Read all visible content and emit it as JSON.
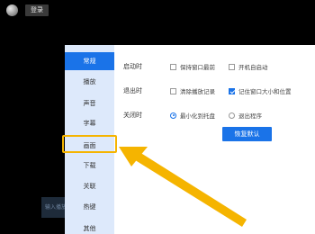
{
  "header": {
    "login_label": "登录"
  },
  "bottom_input": {
    "placeholder": "输入播放"
  },
  "sidebar": {
    "items": [
      {
        "label": "常规"
      },
      {
        "label": "播放"
      },
      {
        "label": "声音"
      },
      {
        "label": "字幕"
      },
      {
        "label": "画面"
      },
      {
        "label": "下载"
      },
      {
        "label": "关联"
      },
      {
        "label": "热键"
      },
      {
        "label": "其他"
      }
    ]
  },
  "settings": {
    "startup": {
      "label": "启动时",
      "options": [
        {
          "label": "保持窗口最前",
          "checked": false
        },
        {
          "label": "开机自启动",
          "checked": false
        }
      ]
    },
    "exit": {
      "label": "退出时",
      "options": [
        {
          "label": "清除播放记录",
          "checked": false
        },
        {
          "label": "记住窗口大小和位置",
          "checked": true
        }
      ]
    },
    "close": {
      "label": "关闭时",
      "options": [
        {
          "label": "最小化到托盘",
          "selected": true
        },
        {
          "label": "退出程序",
          "selected": false
        }
      ]
    },
    "restore_label": "恢复默认"
  },
  "colors": {
    "accent": "#1a73e8",
    "highlight": "#f5b400",
    "sidebar_bg": "#dde9fb"
  }
}
